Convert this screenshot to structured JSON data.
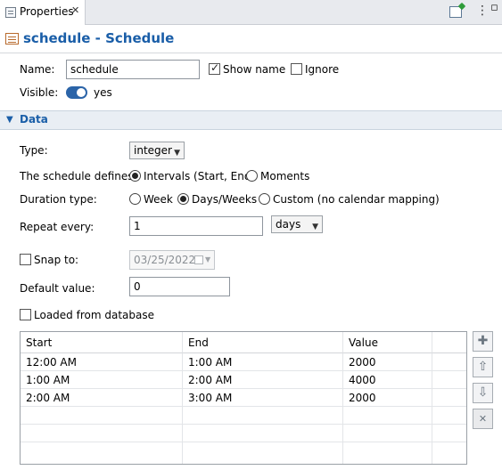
{
  "tab": {
    "label": "Properties",
    "close": "✕",
    "menu": "⋮",
    "minimize": "▫"
  },
  "header": {
    "title": "schedule - Schedule"
  },
  "name": {
    "label": "Name:",
    "value": "schedule"
  },
  "show_name": {
    "label": "Show name",
    "checked": true
  },
  "ignore": {
    "label": "Ignore",
    "checked": false
  },
  "visible": {
    "label": "Visible:",
    "value": "yes"
  },
  "data_section": {
    "label": "Data",
    "chevron": "▼"
  },
  "type": {
    "label": "Type:",
    "value": "integer"
  },
  "defines": {
    "label": "The schedule defines:",
    "options": [
      "Intervals (Start, End)",
      "Moments"
    ],
    "selected": "Intervals (Start, End)"
  },
  "duration": {
    "label": "Duration type:",
    "options": [
      "Week",
      "Days/Weeks",
      "Custom (no calendar mapping)"
    ],
    "selected": "Days/Weeks"
  },
  "repeat": {
    "label": "Repeat every:",
    "value": "1",
    "unit": "days"
  },
  "snap": {
    "label": "Snap to:",
    "checked": false,
    "date": "03/25/2022"
  },
  "default_value": {
    "label": "Default value:",
    "value": "0"
  },
  "loaded_db": {
    "label": "Loaded from database",
    "checked": false
  },
  "table": {
    "columns": [
      "Start",
      "End",
      "Value"
    ],
    "rows": [
      [
        "12:00 AM",
        "1:00 AM",
        "2000"
      ],
      [
        "1:00 AM",
        "2:00 AM",
        "4000"
      ],
      [
        "2:00 AM",
        "3:00 AM",
        "2000"
      ]
    ]
  },
  "table_buttons": {
    "add": "✚",
    "up": "⇧",
    "down": "⇩",
    "delete": "✕"
  },
  "colors": {
    "accent": "#1a5ea8",
    "toggle": "#2b64a8",
    "section_bg": "#e9eef4"
  }
}
